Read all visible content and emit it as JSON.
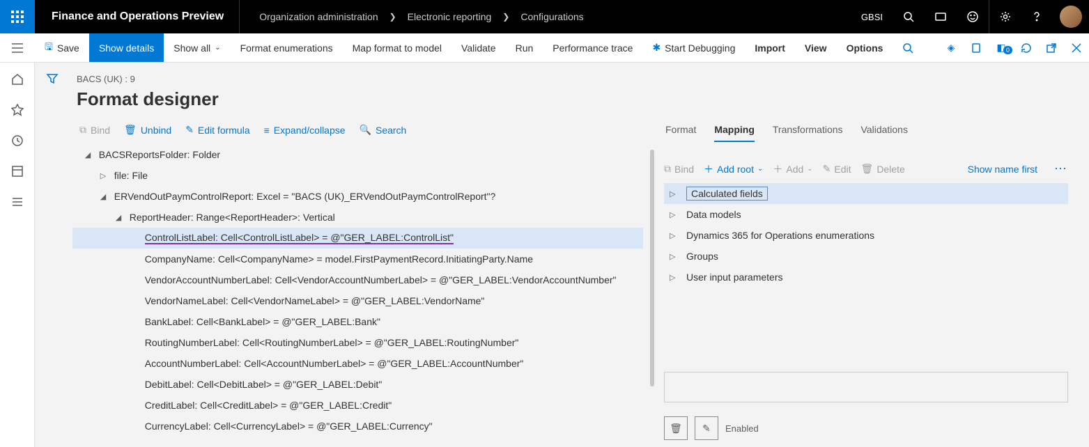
{
  "header": {
    "app_title": "Finance and Operations Preview",
    "breadcrumb": [
      "Organization administration",
      "Electronic reporting",
      "Configurations"
    ],
    "company": "GBSI"
  },
  "cmdbar": {
    "save": "Save",
    "show_details": "Show details",
    "show_all": "Show all",
    "format_enum": "Format enumerations",
    "map_format": "Map format to model",
    "validate": "Validate",
    "run": "Run",
    "perf_trace": "Performance trace",
    "start_debug": "Start Debugging",
    "import": "Import",
    "view": "View",
    "options": "Options",
    "badge": "0"
  },
  "page": {
    "subtitle": "BACS (UK) : 9",
    "title": "Format designer"
  },
  "left_toolbar": {
    "bind": "Bind",
    "unbind": "Unbind",
    "edit_formula": "Edit formula",
    "expand": "Expand/collapse",
    "search": "Search"
  },
  "tree": [
    {
      "indent": 0,
      "caret": "down",
      "text": "BACSReportsFolder: Folder",
      "selected": false
    },
    {
      "indent": 1,
      "caret": "right",
      "text": "file: File",
      "selected": false
    },
    {
      "indent": 1,
      "caret": "down",
      "text": "ERVendOutPaymControlReport: Excel = \"BACS (UK)_ERVendOutPaymControlReport\"?",
      "selected": false
    },
    {
      "indent": 2,
      "caret": "down",
      "text": "ReportHeader: Range<ReportHeader>: Vertical",
      "selected": false
    },
    {
      "indent": 3,
      "caret": "",
      "text": "ControlListLabel: Cell<ControlListLabel> = @\"GER_LABEL:ControlList\"",
      "selected": true
    },
    {
      "indent": 3,
      "caret": "",
      "text": "CompanyName: Cell<CompanyName> = model.FirstPaymentRecord.InitiatingParty.Name",
      "selected": false
    },
    {
      "indent": 3,
      "caret": "",
      "text": "VendorAccountNumberLabel: Cell<VendorAccountNumberLabel> = @\"GER_LABEL:VendorAccountNumber\"",
      "selected": false
    },
    {
      "indent": 3,
      "caret": "",
      "text": "VendorNameLabel: Cell<VendorNameLabel> = @\"GER_LABEL:VendorName\"",
      "selected": false
    },
    {
      "indent": 3,
      "caret": "",
      "text": "BankLabel: Cell<BankLabel> = @\"GER_LABEL:Bank\"",
      "selected": false
    },
    {
      "indent": 3,
      "caret": "",
      "text": "RoutingNumberLabel: Cell<RoutingNumberLabel> = @\"GER_LABEL:RoutingNumber\"",
      "selected": false
    },
    {
      "indent": 3,
      "caret": "",
      "text": "AccountNumberLabel: Cell<AccountNumberLabel> = @\"GER_LABEL:AccountNumber\"",
      "selected": false
    },
    {
      "indent": 3,
      "caret": "",
      "text": "DebitLabel: Cell<DebitLabel> = @\"GER_LABEL:Debit\"",
      "selected": false
    },
    {
      "indent": 3,
      "caret": "",
      "text": "CreditLabel: Cell<CreditLabel> = @\"GER_LABEL:Credit\"",
      "selected": false
    },
    {
      "indent": 3,
      "caret": "",
      "text": "CurrencyLabel: Cell<CurrencyLabel> = @\"GER_LABEL:Currency\"",
      "selected": false
    }
  ],
  "tabs": [
    "Format",
    "Mapping",
    "Transformations",
    "Validations"
  ],
  "active_tab": 1,
  "rtoolbar": {
    "bind": "Bind",
    "add_root": "Add root",
    "add": "Add",
    "edit": "Edit",
    "delete": "Delete",
    "show_name": "Show name first"
  },
  "datasources": [
    {
      "text": "Calculated fields",
      "highlight": true
    },
    {
      "text": "Data models",
      "highlight": false
    },
    {
      "text": "Dynamics 365 for Operations enumerations",
      "highlight": false
    },
    {
      "text": "Groups",
      "highlight": false
    },
    {
      "text": "User input parameters",
      "highlight": false
    }
  ],
  "bottom": {
    "enabled": "Enabled"
  }
}
